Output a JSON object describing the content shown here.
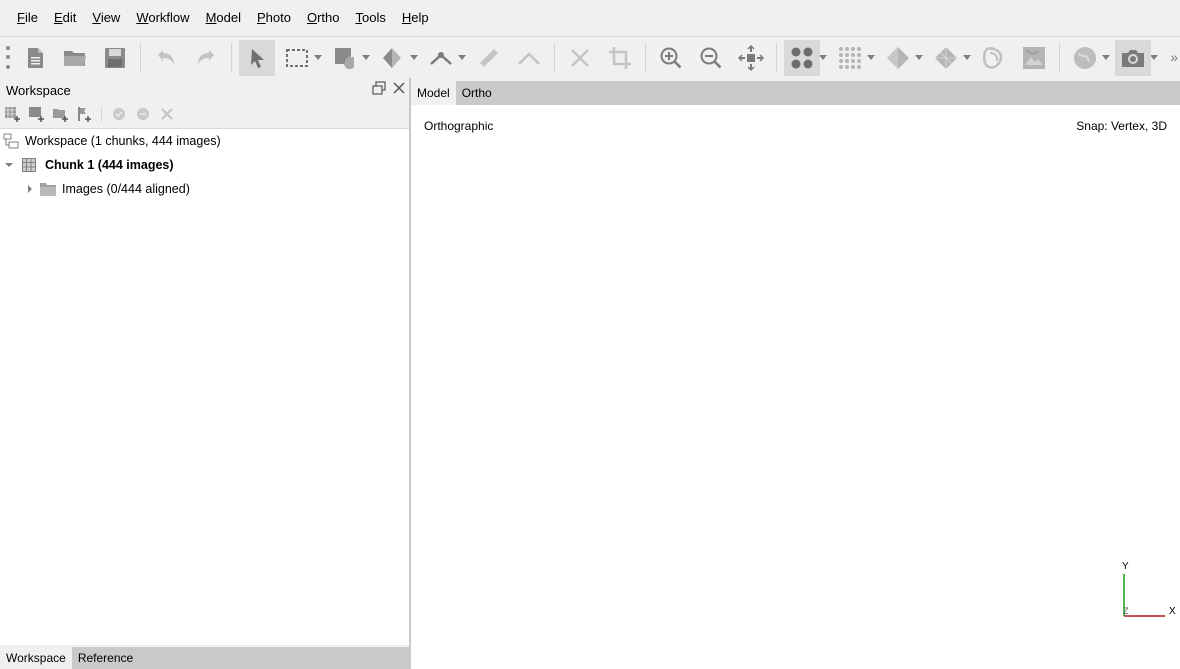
{
  "menubar": {
    "items": [
      {
        "u": "F",
        "rest": "ile"
      },
      {
        "u": "E",
        "rest": "dit"
      },
      {
        "u": "V",
        "rest": "iew"
      },
      {
        "u": "W",
        "rest": "orkflow"
      },
      {
        "u": "M",
        "rest": "odel"
      },
      {
        "u": "P",
        "rest": "hoto"
      },
      {
        "u": "O",
        "rest": "rtho"
      },
      {
        "u": "T",
        "rest": "ools"
      },
      {
        "u": "H",
        "rest": "elp"
      }
    ]
  },
  "toolbar": {
    "icons": [
      "new-project-icon",
      "open-folder-icon",
      "save-icon",
      "undo-icon",
      "redo-icon",
      "select-arrow-icon",
      "rectangle-selection-icon",
      "navigation-hand-icon",
      "cut-shape-icon",
      "ruler-icon",
      "crop-icon",
      "zoom-in-icon",
      "zoom-out-icon",
      "reset-view-icon",
      "point-cloud-icon",
      "dense-cloud-icon",
      "model-solid-icon",
      "model-wireframe-icon",
      "tiled-model-icon",
      "orthomosaic-icon",
      "globe-icon",
      "camera-icon"
    ],
    "more": "»"
  },
  "workspace": {
    "title": "Workspace",
    "tree": {
      "root": "Workspace (1 chunks, 444 images)",
      "chunk": "Chunk 1 (444 images)",
      "images": "Images (0/444 aligned)"
    },
    "bottom_tabs": [
      "Workspace",
      "Reference"
    ]
  },
  "view": {
    "tabs": [
      "Model",
      "Ortho"
    ],
    "projection": "Orthographic",
    "snap": "Snap: Vertex, 3D",
    "axes": {
      "y": "Y",
      "x": "X",
      "z": "Z"
    },
    "colors": {
      "y_axis": "#1a9a1a",
      "x_axis": "#b31a1a"
    }
  }
}
